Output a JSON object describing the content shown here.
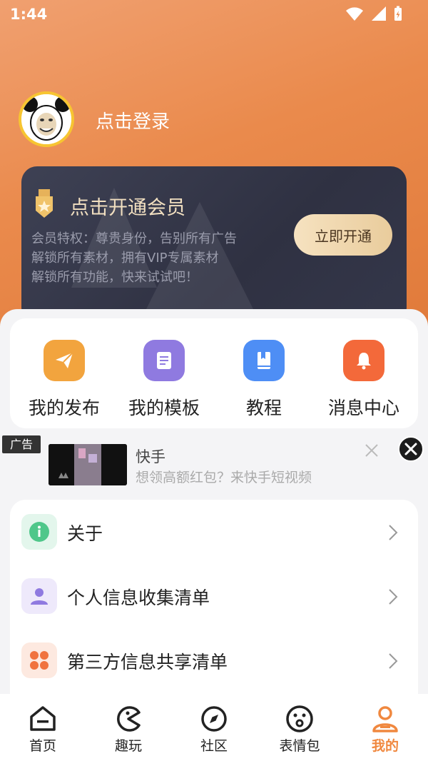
{
  "status_bar": {
    "time": "1:44"
  },
  "profile": {
    "login_text": "点击登录"
  },
  "vip": {
    "title": "点击开通会员",
    "lines": [
      "会员特权：尊贵身份，告别所有广告",
      "解锁所有素材，拥有VIP专属素材",
      "解锁所有功能，快来试试吧！"
    ],
    "button": "立即开通"
  },
  "quick_actions": [
    {
      "label": "我的发布",
      "icon": "send-icon",
      "color": "#f2a43e"
    },
    {
      "label": "我的模板",
      "icon": "template-icon",
      "color": "#8f7ae0"
    },
    {
      "label": "教程",
      "icon": "book-icon",
      "color": "#4e8ef5"
    },
    {
      "label": "消息中心",
      "icon": "bell-icon",
      "color": "#f3693a"
    }
  ],
  "ad": {
    "tag": "广告",
    "title": "快手",
    "description": "想领高额红包？来快手短视频"
  },
  "menu": [
    {
      "label": "关于",
      "icon": "info-icon",
      "color": "#4fc78a"
    },
    {
      "label": "个人信息收集清单",
      "icon": "person-icon",
      "color": "#8f7ae0"
    },
    {
      "label": "第三方信息共享清单",
      "icon": "grid-icon",
      "color": "#f0733f"
    }
  ],
  "tabs": [
    {
      "label": "首页",
      "icon": "home-icon",
      "active": false
    },
    {
      "label": "趣玩",
      "icon": "pacman-icon",
      "active": false
    },
    {
      "label": "社区",
      "icon": "compass-icon",
      "active": false
    },
    {
      "label": "表情包",
      "icon": "emoji-icon",
      "active": false
    },
    {
      "label": "我的",
      "icon": "profile-icon",
      "active": true
    }
  ],
  "colors": {
    "accent": "#f0883f",
    "hero_start": "#f0a070",
    "hero_end": "#e07a3a"
  }
}
